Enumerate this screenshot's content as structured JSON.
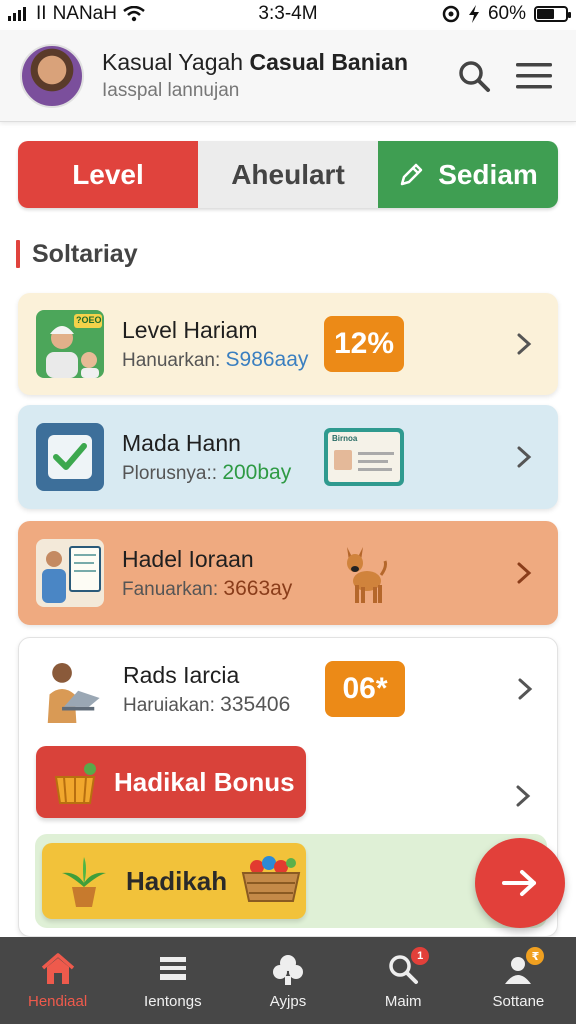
{
  "status": {
    "carrier": "NANaH",
    "time": "3:3-4M",
    "battery": "60%",
    "battery_level": 0.6
  },
  "header": {
    "title_plain": "Kasual Yagah ",
    "title_bold": "Casual Banian",
    "subtitle": "Iasspal lannujan"
  },
  "tabs": [
    "Level",
    "Aheulart",
    "Sediam"
  ],
  "section": {
    "label": "Soltariay"
  },
  "items": [
    {
      "title": "Level Hariam",
      "sub_label": "Hanuarkan: ",
      "sub_value": "S986aay",
      "badge": "12%",
      "thumb_label": "?OEO"
    },
    {
      "title": "Mada Hann",
      "sub_label": "Plorusnya:: ",
      "sub_value": "200bay",
      "minicard_label": "Birnoa"
    },
    {
      "title": "Hadel Ioraan",
      "sub_label": "Fanuarkan: ",
      "sub_value": "3663ay"
    },
    {
      "title": "Rads Iarcia",
      "sub_label": "Haruiakan: ",
      "sub_value": "335406",
      "badge": "06*"
    }
  ],
  "badges_suffix": "*",
  "bonus": [
    {
      "label": "Hadikal Bonus"
    },
    {
      "label": "Hadikah"
    }
  ],
  "colors": {
    "red": "#e0433d",
    "green": "#3f9e52",
    "orange": "#ec8a17",
    "blue_value": "#3a7fc0",
    "green_value": "#2e9a44",
    "orange_value": "#8a3d1a"
  },
  "nav": [
    {
      "label": "Hendiaal",
      "icon": "home-icon",
      "active": true
    },
    {
      "label": "Ientongs",
      "icon": "list-icon"
    },
    {
      "label": "Ayjps",
      "icon": "apps-icon"
    },
    {
      "label": "Maim",
      "icon": "search-icon",
      "badge": "1"
    },
    {
      "label": "Sottane",
      "icon": "profile-icon",
      "badge": "₹"
    }
  ]
}
